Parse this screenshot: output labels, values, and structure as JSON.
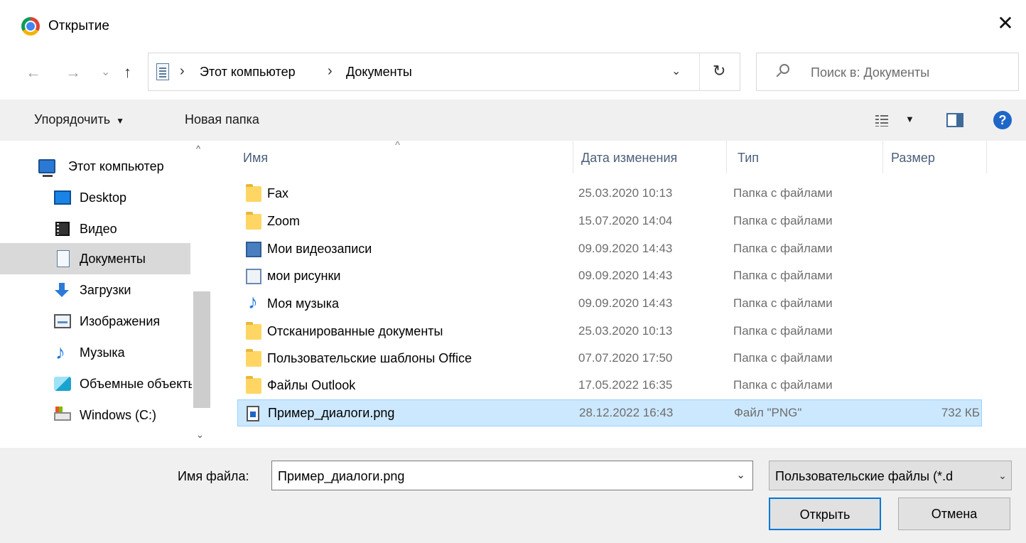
{
  "window": {
    "title": "Открытие",
    "close_glyph": "✕",
    "app_icon": "chrome-icon"
  },
  "navigation": {
    "back_glyph": "←",
    "forward_glyph": "→",
    "recent_glyph": "⌄",
    "up_glyph": "↑",
    "breadcrumb": [
      "Этот компьютер",
      "Документы"
    ],
    "separator": "›",
    "dropdown_glyph": "⌄",
    "refresh_glyph": "↻",
    "search_placeholder": "Поиск в: Документы"
  },
  "toolbar": {
    "organize_label": "Упорядочить",
    "organize_caret": "▼",
    "new_folder_label": "Новая папка",
    "view_caret": "▼",
    "help_glyph": "?"
  },
  "sidebar": {
    "items": [
      {
        "label": "Этот компьютер",
        "icon": "computer-icon"
      },
      {
        "label": "Desktop",
        "icon": "desktop-icon"
      },
      {
        "label": "Видео",
        "icon": "video-icon"
      },
      {
        "label": "Документы",
        "icon": "documents-icon",
        "selected": true
      },
      {
        "label": "Загрузки",
        "icon": "downloads-icon"
      },
      {
        "label": "Изображения",
        "icon": "images-icon"
      },
      {
        "label": "Музыка",
        "icon": "music-icon"
      },
      {
        "label": "Объемные объекты",
        "icon": "3d-objects-icon"
      },
      {
        "label": "Windows (C:)",
        "icon": "drive-icon"
      }
    ],
    "scroll_up_glyph": "^",
    "scroll_down_glyph": "⌄"
  },
  "file_list": {
    "columns": [
      "Имя",
      "Дата изменения",
      "Тип",
      "Размер"
    ],
    "sort_glyph": "^",
    "rows": [
      {
        "name": "Fax",
        "date": "25.03.2020 10:13",
        "type": "Папка с файлами",
        "size": "",
        "icon": "folder-icon"
      },
      {
        "name": "Zoom",
        "date": "15.07.2020 14:04",
        "type": "Папка с файлами",
        "size": "",
        "icon": "folder-icon"
      },
      {
        "name": "Мои видеозаписи",
        "date": "09.09.2020 14:43",
        "type": "Папка с файлами",
        "size": "",
        "icon": "video-shortcut-icon"
      },
      {
        "name": "мои рисунки",
        "date": "09.09.2020 14:43",
        "type": "Папка с файлами",
        "size": "",
        "icon": "pictures-shortcut-icon"
      },
      {
        "name": "Моя музыка",
        "date": "09.09.2020 14:43",
        "type": "Папка с файлами",
        "size": "",
        "icon": "music-shortcut-icon"
      },
      {
        "name": "Отсканированные документы",
        "date": "25.03.2020 10:13",
        "type": "Папка с файлами",
        "size": "",
        "icon": "folder-icon"
      },
      {
        "name": "Пользовательские шаблоны Office",
        "date": "07.07.2020 17:50",
        "type": "Папка с файлами",
        "size": "",
        "icon": "folder-icon"
      },
      {
        "name": "Файлы Outlook",
        "date": "17.05.2022 16:35",
        "type": "Папка с файлами",
        "size": "",
        "icon": "folder-icon"
      },
      {
        "name": "Пример_диалоги.png",
        "date": "28.12.2022 16:43",
        "type": "Файл \"PNG\"",
        "size": "732 КБ",
        "icon": "png-file-icon",
        "selected": true
      }
    ]
  },
  "footer": {
    "filename_label": "Имя файла:",
    "filename_value": "Пример_диалоги.png",
    "filename_dropdown_glyph": "⌄",
    "filter_value": "Пользовательские файлы (*.d",
    "filter_dropdown_glyph": "⌄",
    "open_label": "Открыть",
    "cancel_label": "Отмена"
  },
  "colors": {
    "accent": "#0078d7",
    "selection": "#cce8ff",
    "selection_border": "#99d1ff",
    "toolbar_bg": "#f0f0f0"
  }
}
